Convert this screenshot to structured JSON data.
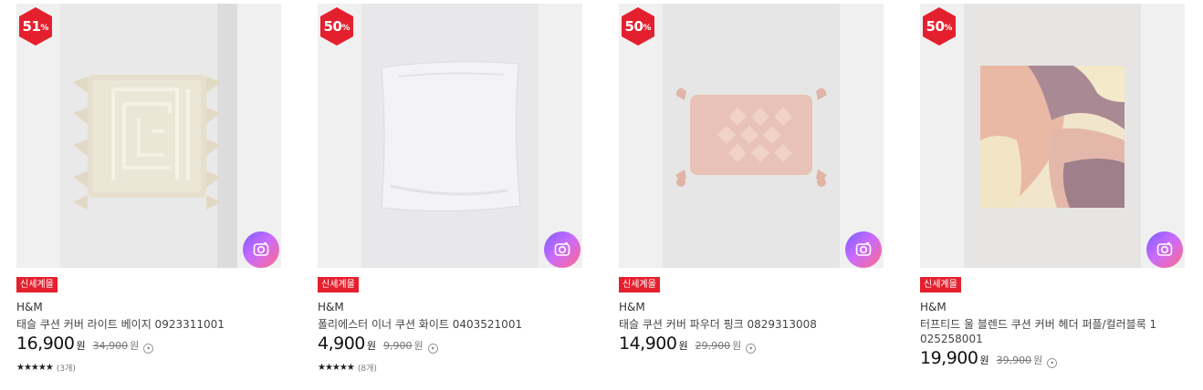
{
  "products": [
    {
      "discount": "51",
      "discount_unit": "%",
      "tag": "신세계몰",
      "brand": "H&M",
      "name": "태슬 쿠션 커버 라이트 베이지 0923311001",
      "price": "16,900",
      "price_unit": "원",
      "original_price": "34,900",
      "original_unit": "원",
      "stars": "★★★★★",
      "rating_fraction": 1.0,
      "review_count": "(3개)"
    },
    {
      "discount": "50",
      "discount_unit": "%",
      "tag": "신세계몰",
      "brand": "H&M",
      "name": "폴리에스터 이너 쿠션 화이트 0403521001",
      "price": "4,900",
      "price_unit": "원",
      "original_price": "9,900",
      "original_unit": "원",
      "stars": "★★★★★",
      "rating_fraction": 0.9,
      "review_count": "(8개)"
    },
    {
      "discount": "50",
      "discount_unit": "%",
      "tag": "신세계몰",
      "brand": "H&M",
      "name": "태슬 쿠션 커버 파우더 핑크 0829313008",
      "price": "14,900",
      "price_unit": "원",
      "original_price": "29,900",
      "original_unit": "원"
    },
    {
      "discount": "50",
      "discount_unit": "%",
      "tag": "신세계몰",
      "brand": "H&M",
      "name": "터프티드 울 블렌드 쿠션 커버 헤더 퍼플/컬러블록 1025258001",
      "price": "19,900",
      "price_unit": "원",
      "original_price": "39,900",
      "original_unit": "원"
    }
  ],
  "colors": {
    "badge_red": "#e5202e",
    "tag_red": "#e5202e",
    "camera_gradient": [
      "#7b5cff",
      "#c86bff",
      "#ff6a8a"
    ]
  },
  "icons": {
    "camera": "camera-icon",
    "info": "info-circle-icon",
    "star": "star-icon"
  }
}
